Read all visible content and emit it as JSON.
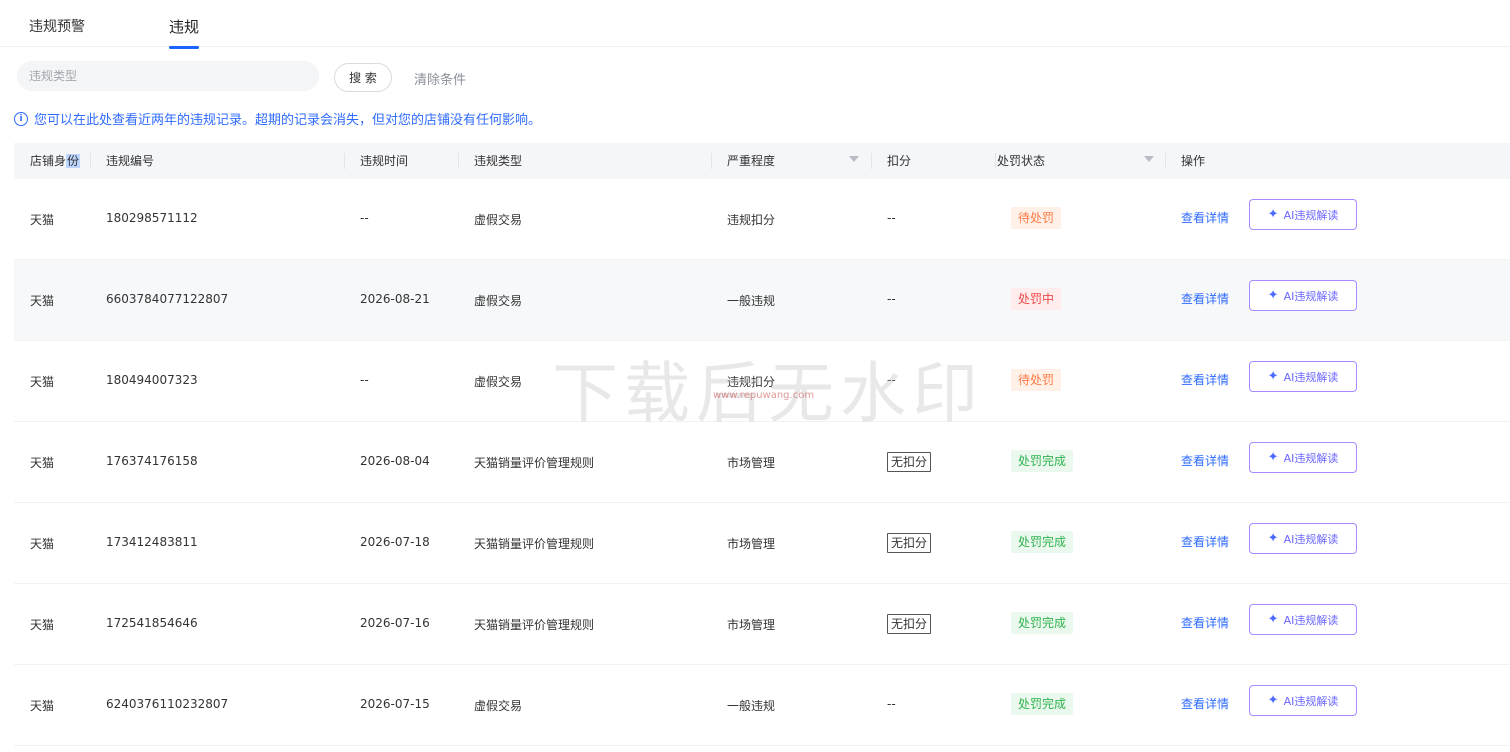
{
  "tabs": [
    {
      "label": "违规预警"
    },
    {
      "label": "违规"
    }
  ],
  "filter": {
    "placeholder": "违规类型",
    "search_label": "搜 索",
    "clear_label": "清除条件"
  },
  "notice": {
    "text": "您可以在此处查看近两年的违规记录。超期的记录会消失，但对您的店铺没有任何影响。"
  },
  "table": {
    "columns": {
      "identity_a": "店铺身",
      "identity_b": "份",
      "id": "违规编号",
      "time": "违规时间",
      "type": "违规类型",
      "severity": "严重程度",
      "points": "扣分",
      "status": "处罚状态",
      "actions": "操作"
    },
    "rows": [
      {
        "identity": "天猫",
        "id": "180298571112",
        "time": "--",
        "type": "虚假交易",
        "severity": "违规扣分",
        "points": "--",
        "status": "待处罚",
        "detail": "查看详情",
        "ai": "AI违规解读"
      },
      {
        "identity": "天猫",
        "id": "6603784077122807",
        "time": "2026-08-21",
        "type": "虚假交易",
        "severity": "一般违规",
        "points": "--",
        "status": "处罚中",
        "detail": "查看详情",
        "ai": "AI违规解读"
      },
      {
        "identity": "天猫",
        "id": "180494007323",
        "time": "--",
        "type": "虚假交易",
        "severity": "违规扣分",
        "points": "--",
        "status": "待处罚",
        "detail": "查看详情",
        "ai": "AI违规解读"
      },
      {
        "identity": "天猫",
        "id": "176374176158",
        "time": "2026-08-04",
        "type": "天猫销量评价管理规则",
        "severity": "市场管理",
        "points": "无扣分",
        "status": "处罚完成",
        "detail": "查看详情",
        "ai": "AI违规解读"
      },
      {
        "identity": "天猫",
        "id": "173412483811",
        "time": "2026-07-18",
        "type": "天猫销量评价管理规则",
        "severity": "市场管理",
        "points": "无扣分",
        "status": "处罚完成",
        "detail": "查看详情",
        "ai": "AI违规解读"
      },
      {
        "identity": "天猫",
        "id": "172541854646",
        "time": "2026-07-16",
        "type": "天猫销量评价管理规则",
        "severity": "市场管理",
        "points": "无扣分",
        "status": "处罚完成",
        "detail": "查看详情",
        "ai": "AI违规解读"
      },
      {
        "identity": "天猫",
        "id": "6240376110232807",
        "time": "2026-07-15",
        "type": "虚假交易",
        "severity": "一般违规",
        "points": "--",
        "status": "处罚完成",
        "detail": "查看详情",
        "ai": "AI违规解读"
      }
    ]
  },
  "watermark": {
    "main": "下载后无水印",
    "sub": "www.repuwang.com"
  }
}
